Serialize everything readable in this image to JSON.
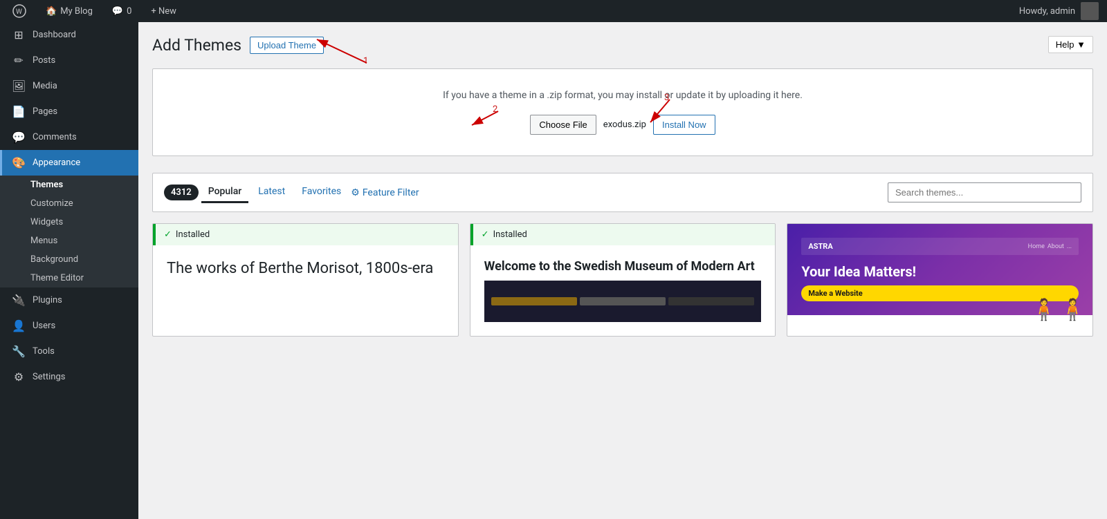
{
  "adminbar": {
    "wp_logo": "⊞",
    "site_name": "My Blog",
    "comments_label": "0",
    "new_label": "+ New",
    "howdy": "Howdy, admin"
  },
  "sidebar": {
    "menu_items": [
      {
        "id": "dashboard",
        "label": "Dashboard",
        "icon": "⊞"
      },
      {
        "id": "posts",
        "label": "Posts",
        "icon": "✎"
      },
      {
        "id": "media",
        "label": "Media",
        "icon": "🖼"
      },
      {
        "id": "pages",
        "label": "Pages",
        "icon": "📄"
      },
      {
        "id": "comments",
        "label": "Comments",
        "icon": "💬"
      },
      {
        "id": "appearance",
        "label": "Appearance",
        "icon": "🎨",
        "active": true
      },
      {
        "id": "plugins",
        "label": "Plugins",
        "icon": "🔌"
      },
      {
        "id": "users",
        "label": "Users",
        "icon": "👤"
      },
      {
        "id": "tools",
        "label": "Tools",
        "icon": "🔧"
      },
      {
        "id": "settings",
        "label": "Settings",
        "icon": "⚙"
      }
    ],
    "submenu": [
      {
        "id": "themes",
        "label": "Themes",
        "active": true
      },
      {
        "id": "customize",
        "label": "Customize"
      },
      {
        "id": "widgets",
        "label": "Widgets"
      },
      {
        "id": "menus",
        "label": "Menus"
      },
      {
        "id": "background",
        "label": "Background"
      },
      {
        "id": "theme-editor",
        "label": "Theme Editor"
      }
    ]
  },
  "page": {
    "title": "Add Themes",
    "upload_theme_btn": "Upload Theme",
    "help_btn": "Help ▼",
    "upload_desc": "If you have a theme in a .zip format, you may install or update it by uploading it here.",
    "choose_file_btn": "Choose File",
    "file_name": "exodus.zip",
    "install_now_btn": "Install Now",
    "step1": "1",
    "step2": "2",
    "step3": "3"
  },
  "theme_tabs": {
    "count": "4312",
    "tabs": [
      {
        "id": "popular",
        "label": "Popular",
        "active": true
      },
      {
        "id": "latest",
        "label": "Latest"
      },
      {
        "id": "favorites",
        "label": "Favorites"
      }
    ],
    "feature_filter": "Feature Filter",
    "search_placeholder": "Search themes..."
  },
  "theme_cards": [
    {
      "installed": true,
      "installed_label": "Installed",
      "title": "The works of Berthe Morisot, 1800s-era"
    },
    {
      "installed": true,
      "installed_label": "Installed",
      "title": "Welcome to the Swedish Museum of Modern Art"
    },
    {
      "installed": false,
      "brand": "ASTRA",
      "headline": "Your Idea Matters!",
      "subline": "",
      "cta": "Make a Website"
    }
  ]
}
